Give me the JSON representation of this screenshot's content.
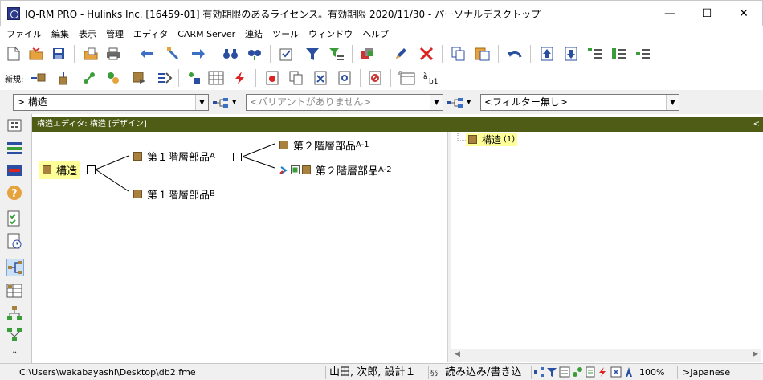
{
  "window": {
    "title": "IQ-RM PRO - Hulinks Inc. [16459-01] 有効期限のあるライセンス。有効期限 2020/11/30 - パーソナルデスクトップ",
    "minimize": "—",
    "maximize": "☐",
    "close": "✕"
  },
  "menu": [
    "ファイル",
    "編集",
    "表示",
    "管理",
    "エディタ",
    "CARM Server",
    "連結",
    "ツール",
    "ウィンドウ",
    "ヘルプ"
  ],
  "toolbar2": {
    "label": "新規:"
  },
  "filter": {
    "structure_value": "> 構造",
    "variant_placeholder": "<バリアントがありません>",
    "filter_value": "<フィルター無し>"
  },
  "editor": {
    "header": "構造エディタ: 構造 [デザイン]",
    "collapse": "<"
  },
  "tree": {
    "root": "構造",
    "a": "第１階層部品",
    "a_sub": "A",
    "b": "第１階層部品",
    "b_sub": "B",
    "a1": "第２階層部品",
    "a1_sub": "A-1",
    "a2": "第２階層部品",
    "a2_sub": "A-2"
  },
  "right_tree": {
    "label": "構造",
    "count": "(1)"
  },
  "status": {
    "path": "C:\\Users\\wakabayashi\\Desktop\\db2.fme",
    "user": "山田, 次郎, 設計１",
    "access": "読み込み/書き込",
    "zoom": "100%",
    "lang": ">Japanese"
  },
  "colors": {
    "editor_header": "#4e5c16",
    "item_square": "#a8813e",
    "highlight": "#ffff99"
  }
}
